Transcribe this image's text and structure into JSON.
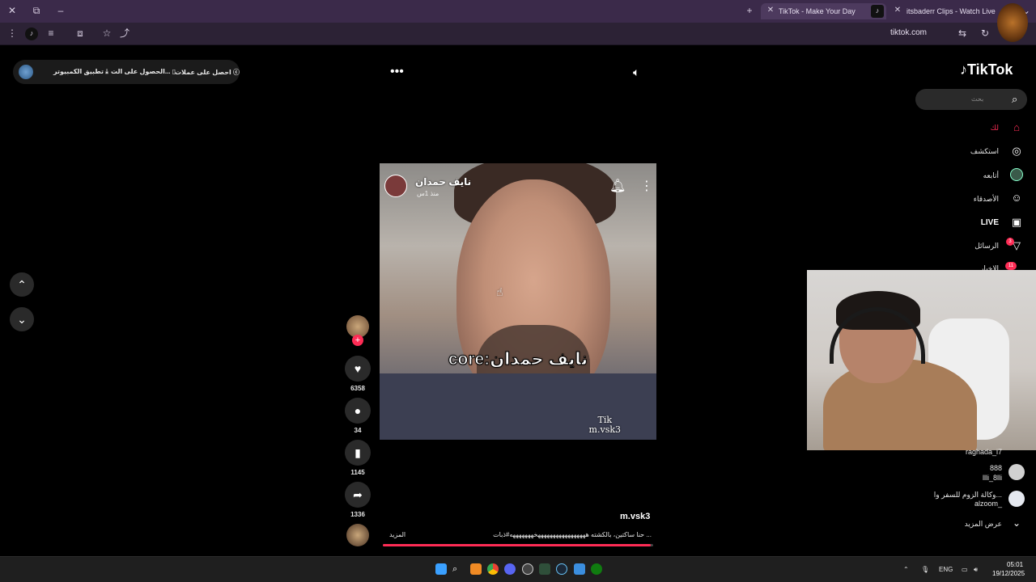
{
  "browser": {
    "tabs": [
      {
        "title": "TikTok - Make Your Day",
        "active": true
      },
      {
        "title": "itsbaderr Clips - Watch Live on",
        "active": false
      }
    ],
    "url": "tiktok.com"
  },
  "topbar": {
    "get_coins": "احصل على عملات",
    "get_app": "الحصول على الت...",
    "desktop_app": "تطبيق الكمبيوتر"
  },
  "sidebar": {
    "logo": "TikTok",
    "search_placeholder": "بحث",
    "items": [
      {
        "label": "لك",
        "icon": "home-icon"
      },
      {
        "label": "استكشف",
        "icon": "compass-icon"
      },
      {
        "label": "أتابعه",
        "icon": "following-icon"
      },
      {
        "label": "الأصدقاء",
        "icon": "friends-icon"
      },
      {
        "label": "LIVE",
        "icon": "live-icon"
      },
      {
        "label": "الرسائل",
        "icon": "messages-icon",
        "badge": "3"
      },
      {
        "label": "الاخبار",
        "icon": "activity-icon",
        "badge": "11"
      }
    ],
    "suggestions": [
      {
        "name": "raghada_i7"
      },
      {
        "name": "888",
        "handle": "llli_8lli"
      },
      {
        "name": "وكالة الزوم للسفر وا...",
        "handle": "alzoom_"
      }
    ],
    "see_more": "عرض المزيد"
  },
  "video": {
    "author_name": "نايف حمدان",
    "posted": "منذ 1س",
    "overlay_text": "core:نايف حمدان",
    "watermark_line1": "Tik",
    "watermark_line2": "m.vsk3",
    "handle": "m.vsk3",
    "description": "حنا ساكتين، بالكشته هههههههههههههههههخهههههههه#ذبات ...",
    "more": "المزيد",
    "progress": 0.99
  },
  "actions": {
    "likes": "6358",
    "comments": "34",
    "saves": "1145",
    "shares": "1336"
  },
  "taskbar": {
    "lang": "ENG",
    "time": "05:01",
    "date": "19/12/2025"
  },
  "colors": {
    "accent": "#fe2c55",
    "browser_frame": "#3b2a4a"
  }
}
